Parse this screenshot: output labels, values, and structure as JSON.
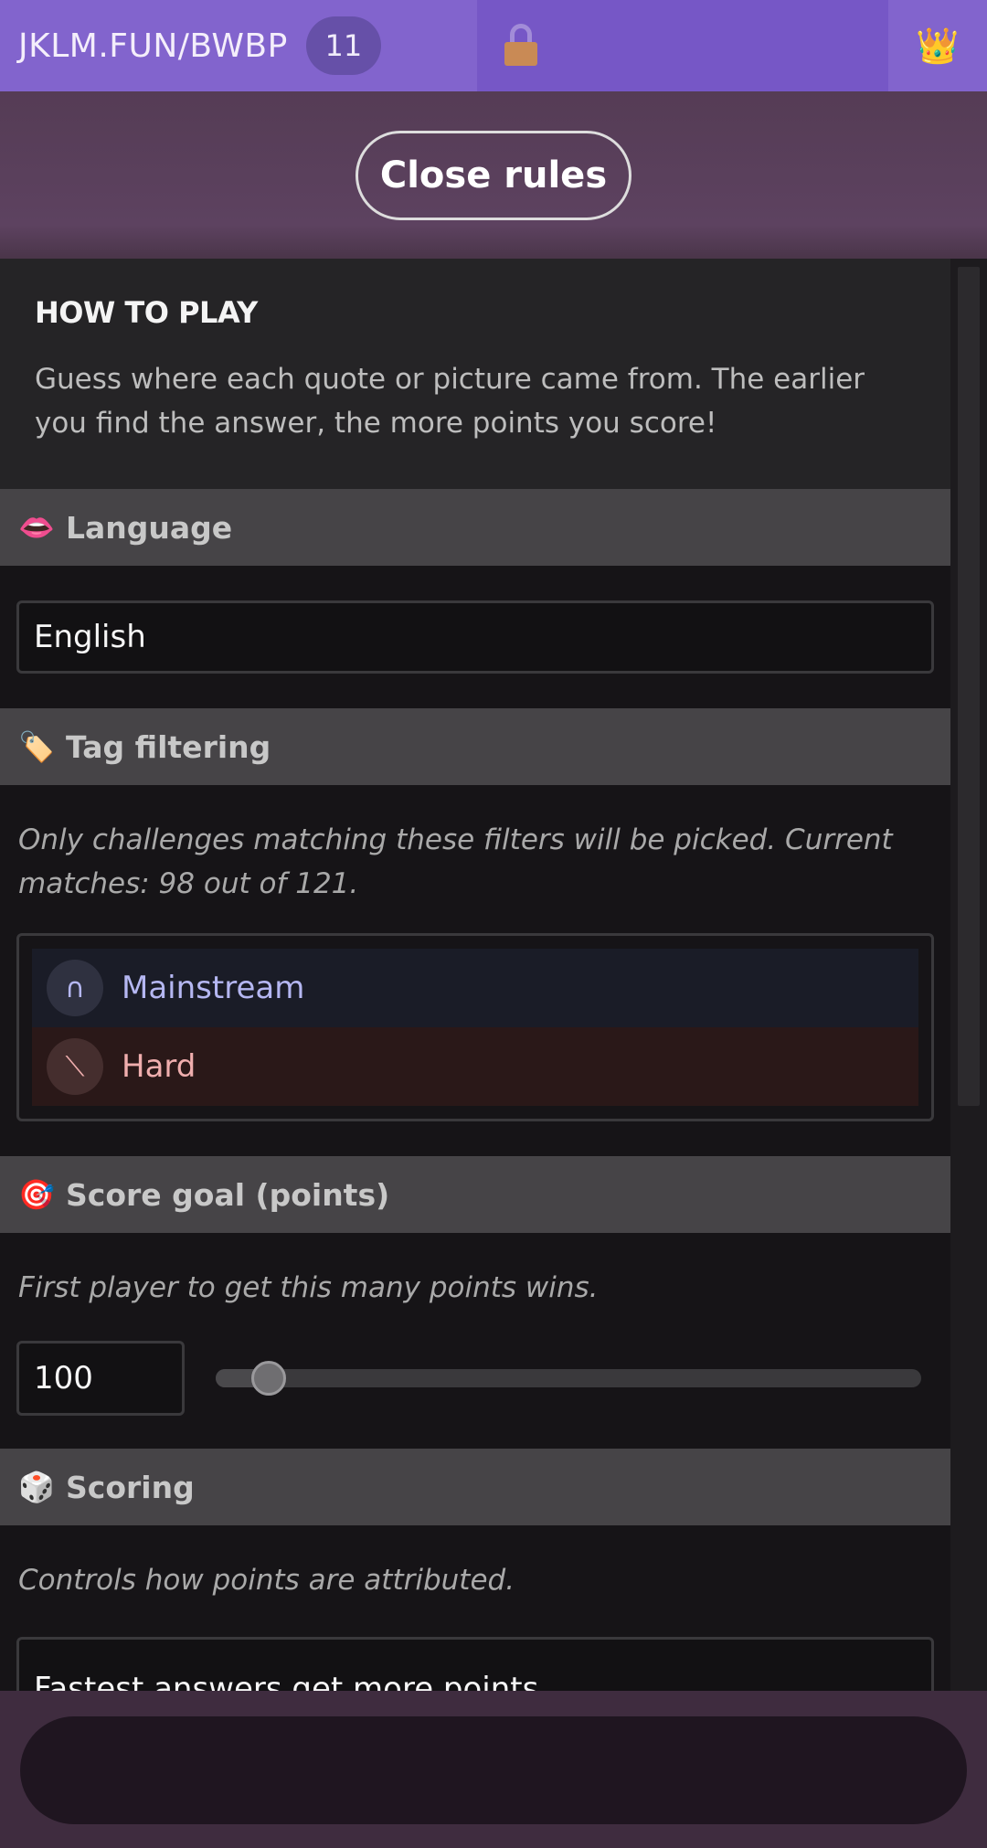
{
  "topbar": {
    "room_code": "JKLM.FUN/BWBP",
    "player_count": "11",
    "lock_icon": "lock-icon",
    "crown_icon": "crown-icon",
    "crown_glyph": "👑",
    "colors": {
      "room_bg": "#8264cd",
      "mid_bg": "#7657c6"
    }
  },
  "rules_header": {
    "close_label": "Close rules"
  },
  "how_to_play": {
    "title": "HOW TO PLAY",
    "text": "Guess where each quote or picture came from. The earlier you find the answer, the more points you score!"
  },
  "sections": {
    "language": {
      "icon": "lips-icon",
      "glyph": "👄",
      "title": "Language",
      "value": "English"
    },
    "tag_filtering": {
      "icon": "label-tag-icon",
      "glyph": "🏷️",
      "title": "Tag filtering",
      "description": "Only challenges matching these filters will be picked. Current matches: 98 out of 121.",
      "tags": [
        {
          "symbol": "∩",
          "label": "Mainstream",
          "mode": "intersection",
          "color": "#b5b7f2"
        },
        {
          "symbol": "⟍",
          "label": "Hard",
          "mode": "exclude",
          "color": "#f0aeae"
        }
      ]
    },
    "score_goal": {
      "icon": "target-icon",
      "glyph": "🎯",
      "title": "Score goal (points)",
      "description": "First player to get this many points wins.",
      "value": "100",
      "slider_fraction": 0.075
    },
    "scoring": {
      "icon": "dice-icon",
      "glyph": "🎲",
      "title": "Scoring",
      "description": "Controls how points are attributed.",
      "value": "Fastest answers get more points"
    }
  },
  "bottom": {
    "chat_placeholder": ""
  }
}
